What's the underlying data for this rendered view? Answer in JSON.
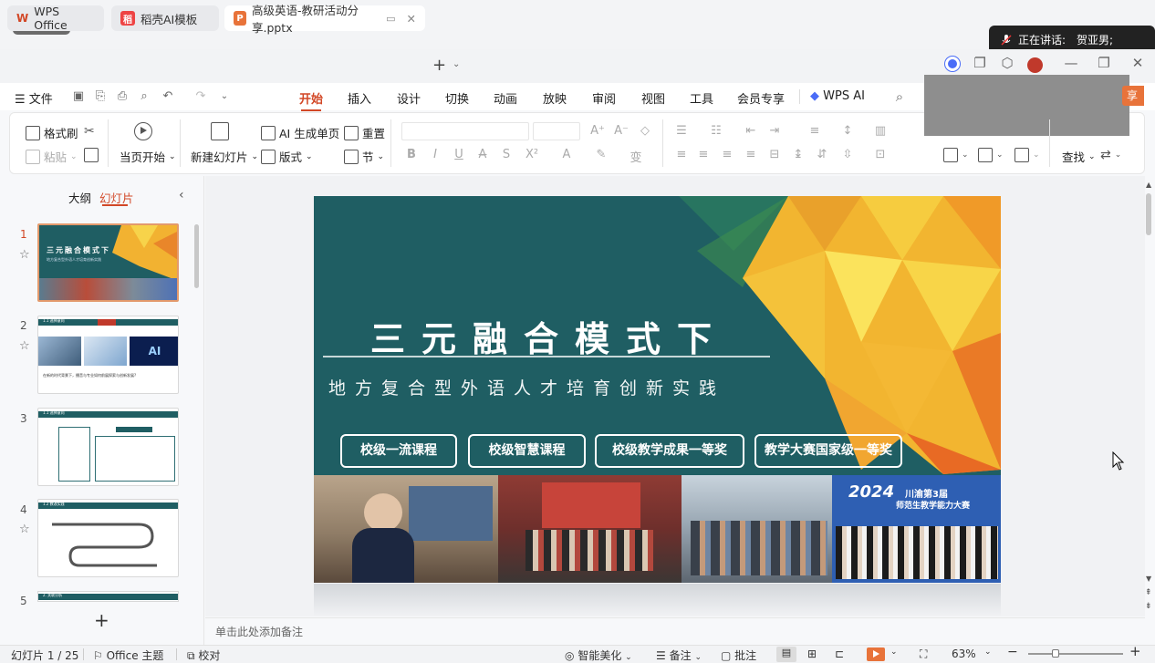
{
  "meeting": {
    "speaking_label": "正在讲话:",
    "speaker": "贺亚男;"
  },
  "tabs": [
    {
      "label": "WPS Office"
    },
    {
      "label": "稻壳AI模板"
    },
    {
      "label": "高级英语-教研活动分享.pptx"
    }
  ],
  "menu": {
    "file": "文件",
    "items": [
      "开始",
      "插入",
      "设计",
      "切换",
      "动画",
      "放映",
      "审阅",
      "视图",
      "工具",
      "会员专享"
    ],
    "wps_ai": "WPS AI",
    "share_label": "享"
  },
  "ribbon": {
    "format_painter": "格式刷",
    "paste": "粘贴",
    "from_current": "当页开始",
    "new_slide": "新建幻灯片",
    "ai_generate": "AI 生成单页",
    "layout": "版式",
    "reset": "重置",
    "section": "节",
    "find": "查找"
  },
  "panel": {
    "outline_tab": "大纲",
    "slides_tab": "幻灯片",
    "add_label": "+"
  },
  "thumbnails": [
    {
      "num": "1",
      "title": "三元融合模式下",
      "sub": "地方复合型外语人才培育创新实践"
    },
    {
      "num": "2",
      "header": "1.1 选择意向",
      "caption": "在新的时代背景下，播音与专业如何前展探索与创新发展?",
      "badge": "AI"
    },
    {
      "num": "3",
      "header": "1.1 选择意向"
    },
    {
      "num": "4",
      "header": "1.2 教改实践"
    },
    {
      "num": "5",
      "header": "2. 关联分析"
    }
  ],
  "slide": {
    "title": "三元融合模式下",
    "subtitle": "地方复合型外语人才培育创新实践",
    "badges": [
      "校级一流课程",
      "校级智慧课程",
      "校级教学成果一等奖",
      "教学大赛国家级一等奖"
    ],
    "photo4_text_year": "2024",
    "photo4_text_title": "川渝第3届",
    "photo4_text_sub": "师范生教学能力大赛"
  },
  "notes_placeholder": "单击此处添加备注",
  "status": {
    "slide_count": "幻灯片 1 / 25",
    "theme": "Office 主题",
    "proof": "校对",
    "beautify": "智能美化",
    "notes": "备注",
    "comments": "批注",
    "zoom": "63%"
  },
  "colors": {
    "accent": "#d24726",
    "slide_bg": "#1f5e63",
    "badge_border": "#ffffff"
  }
}
